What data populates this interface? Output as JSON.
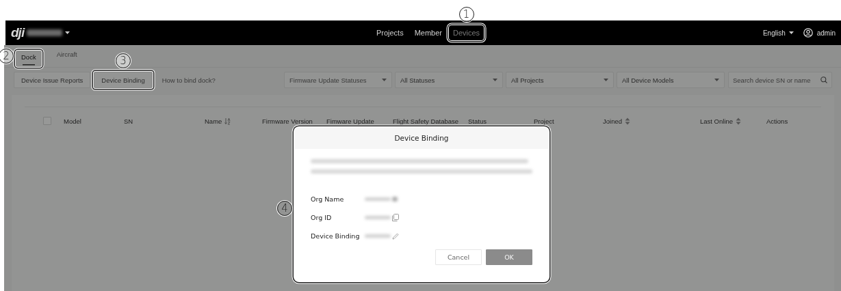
{
  "header": {
    "logo": "dji",
    "nav": [
      {
        "label": "Projects",
        "selected": false
      },
      {
        "label": "Member",
        "selected": false
      },
      {
        "label": "Devices",
        "selected": true,
        "callout": "1"
      }
    ],
    "language": "English",
    "user": "admin"
  },
  "tabs": [
    {
      "label": "Dock",
      "selected": true,
      "callout": "2"
    },
    {
      "label": "Aircraft",
      "selected": false
    }
  ],
  "toolbar": {
    "buttons": [
      {
        "label": "Device Issue Reports"
      },
      {
        "label": "Device Binding",
        "callout": "3"
      }
    ],
    "help_link": "How to bind dock?",
    "filters": [
      {
        "placeholder": "Firmware Update Statuses"
      },
      {
        "value": "All Statuses"
      },
      {
        "value": "All Projects"
      },
      {
        "value": "All Device Models"
      }
    ],
    "search": {
      "placeholder": "Search device SN or name"
    }
  },
  "table": {
    "select_all": {
      "checked": false
    },
    "columns": [
      {
        "label": "Model"
      },
      {
        "label": "SN"
      },
      {
        "label": "Name",
        "kind": "alpha_sort"
      },
      {
        "label": "Firmware Version"
      },
      {
        "label": "Fimware Update"
      },
      {
        "label": "Flight Safety Database"
      },
      {
        "label": "Status"
      },
      {
        "label": "Project"
      },
      {
        "label": "Joined",
        "kind": "updown_sort"
      },
      {
        "label": "Last Online",
        "kind": "updown_sort"
      },
      {
        "label": "Actions"
      }
    ]
  },
  "dialog": {
    "title": "Device Binding",
    "callout": "4",
    "fields": [
      {
        "label": "Org Name",
        "kind": "plain"
      },
      {
        "label": "Org ID",
        "kind": "copy"
      },
      {
        "label": "Device Binding",
        "kind": "edit"
      }
    ],
    "buttons": [
      {
        "label": "Cancel",
        "kind": "secondary"
      },
      {
        "label": "OK",
        "kind": "primary"
      }
    ]
  }
}
